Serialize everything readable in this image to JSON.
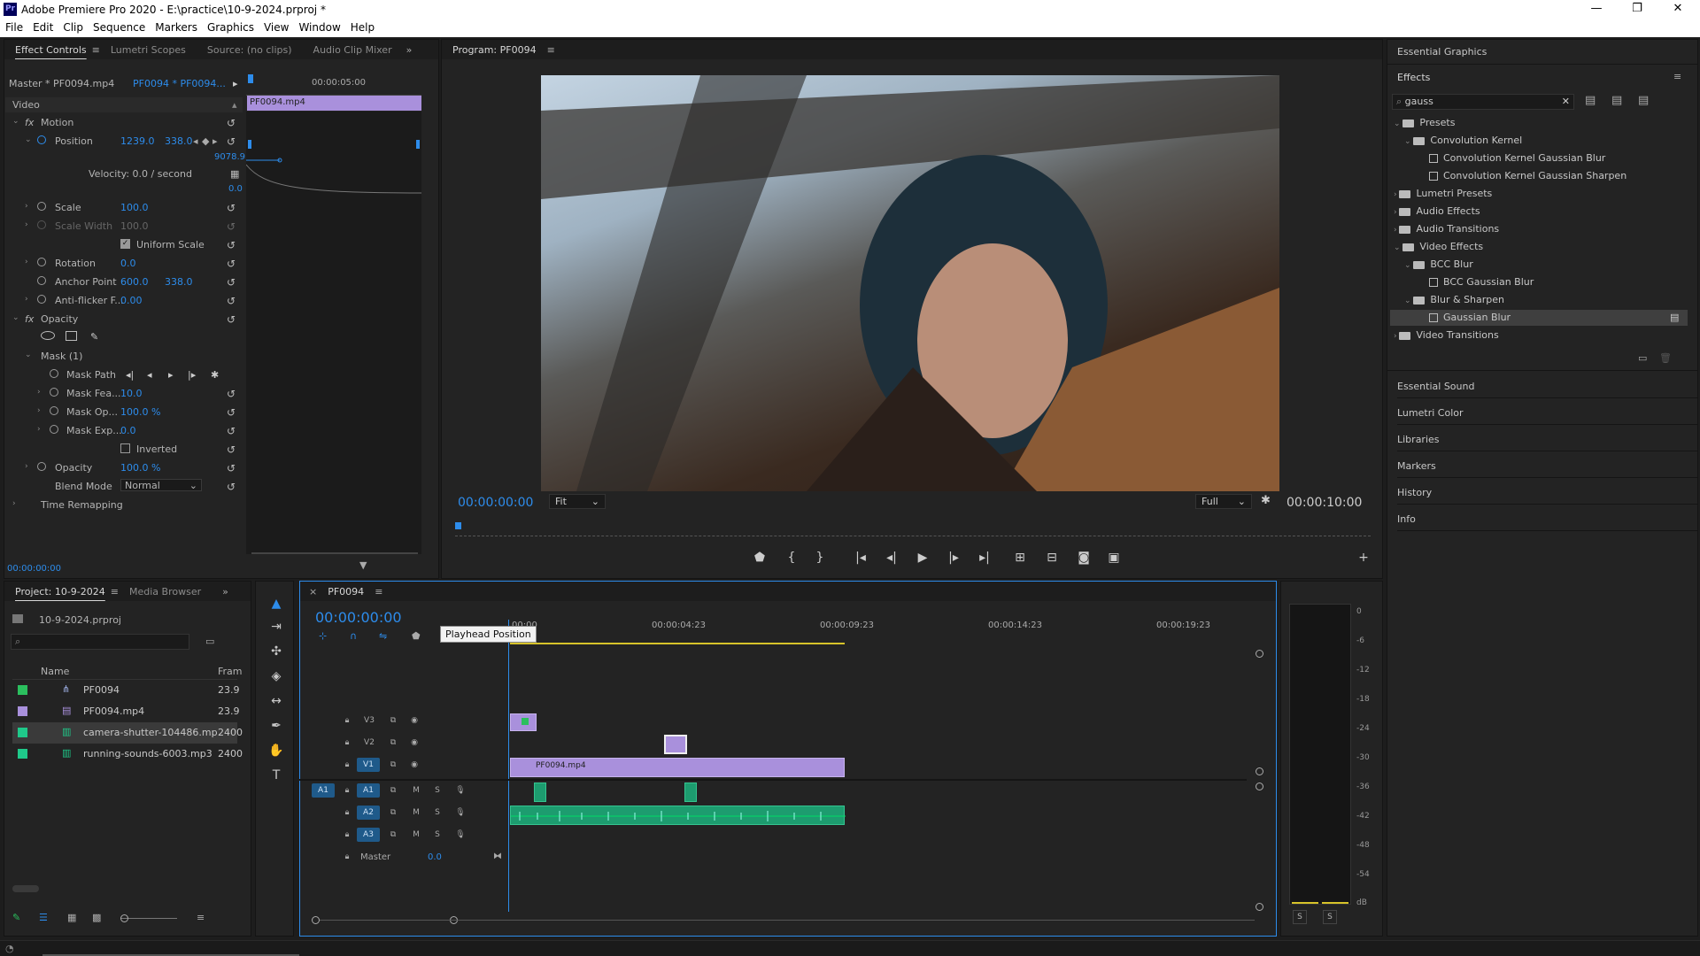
{
  "app": {
    "title": "Adobe Premiere Pro 2020 - E:\\practice\\10-9-2024.prproj *",
    "logo": "Pr",
    "controls": [
      "minimize-icon",
      "maximize-icon",
      "close-icon"
    ]
  },
  "menu": [
    "File",
    "Edit",
    "Clip",
    "Sequence",
    "Markers",
    "Graphics",
    "View",
    "Window",
    "Help"
  ],
  "effect_controls": {
    "tabs": [
      "Effect Controls",
      "Lumetri Scopes",
      "Source: (no clips)",
      "Audio Clip Mixer"
    ],
    "master": "Master * PF0094.mp4",
    "seq": "PF0094 * PF0094...",
    "ruler_time": "00:00:05:00",
    "clip_name": "PF0094.mp4",
    "video_label": "Video",
    "motion": "Motion",
    "position_label": "Position",
    "position_x": "1239.0",
    "position_y": "338.0",
    "velocity_value": "9078.9",
    "velocity": "Velocity: 0.0 / second",
    "velocity_zero": "0.0",
    "scale_label": "Scale",
    "scale": "100.0",
    "scale_width_label": "Scale Width",
    "scale_width": "100.0",
    "uniform_scale": "Uniform Scale",
    "rotation_label": "Rotation",
    "rotation": "0.0",
    "anchor_label": "Anchor Point",
    "anchor_x": "600.0",
    "anchor_y": "338.0",
    "antiflicker_label": "Anti-flicker F...",
    "antiflicker": "0.00",
    "opacity_section": "Opacity",
    "mask": "Mask (1)",
    "mask_path": "Mask Path",
    "mask_feather_label": "Mask Fea...",
    "mask_feather": "10.0",
    "mask_opacity_label": "Mask Op...",
    "mask_opacity": "100.0 %",
    "mask_expansion_label": "Mask Exp...",
    "mask_expansion": "0.0",
    "inverted": "Inverted",
    "opacity_label": "Opacity",
    "opacity": "100.0 %",
    "blend_label": "Blend Mode",
    "blend": "Normal",
    "time_remap": "Time Remapping",
    "timecode": "00:00:00:00"
  },
  "program": {
    "title": "Program: PF0094",
    "timecode": "00:00:00:00",
    "fit": "Fit",
    "quality": "Full",
    "duration": "00:00:10:00"
  },
  "project": {
    "tabs": [
      "Project: 10-9-2024",
      "Media Browser"
    ],
    "file": "10-9-2024.prproj",
    "columns": [
      "Name",
      "Fram"
    ],
    "items": [
      {
        "name": "PF0094",
        "fps": "23.9",
        "color": "#2bbf5e",
        "icon": "sequence-icon"
      },
      {
        "name": "PF0094.mp4",
        "fps": "23.9",
        "color": "#a990dc",
        "icon": "video-file-icon"
      },
      {
        "name": "camera-shutter-104486.mp",
        "fps": "2400",
        "color": "#1fc98a",
        "icon": "audio-file-icon"
      },
      {
        "name": "running-sounds-6003.mp3",
        "fps": "2400",
        "color": "#1fc98a",
        "icon": "audio-file-icon"
      }
    ]
  },
  "timeline": {
    "tab": "PF0094",
    "timecode": "00:00:00:00",
    "tooltip": "Playhead Position",
    "ruler": [
      "00:00",
      "00:00:04:23",
      "00:00:09:23",
      "00:00:14:23",
      "00:00:19:23"
    ],
    "video_tracks": [
      "V3",
      "V2",
      "V1"
    ],
    "audio_tracks": [
      "A1",
      "A2",
      "A3"
    ],
    "master": "Master",
    "master_val": "0.0",
    "clip_v1": "PF0094.mp4",
    "src_a1": "A1",
    "src_v1": "V1",
    "m": "M",
    "s": "S"
  },
  "effects": {
    "essential_graphics": "Essential Graphics",
    "title": "Effects",
    "search": "gauss",
    "tree": [
      {
        "label": "Presets",
        "level": 0,
        "type": "folder",
        "open": true
      },
      {
        "label": "Convolution Kernel",
        "level": 1,
        "type": "folder",
        "open": true
      },
      {
        "label": "Convolution Kernel Gaussian Blur",
        "level": 2,
        "type": "preset"
      },
      {
        "label": "Convolution Kernel Gaussian Sharpen",
        "level": 2,
        "type": "preset"
      },
      {
        "label": "Lumetri Presets",
        "level": 0,
        "type": "folder",
        "open": false
      },
      {
        "label": "Audio Effects",
        "level": 0,
        "type": "folder",
        "open": false
      },
      {
        "label": "Audio Transitions",
        "level": 0,
        "type": "folder",
        "open": false
      },
      {
        "label": "Video Effects",
        "level": 0,
        "type": "folder",
        "open": true
      },
      {
        "label": "BCC Blur",
        "level": 1,
        "type": "folder",
        "open": true
      },
      {
        "label": "BCC Gaussian Blur",
        "level": 2,
        "type": "preset"
      },
      {
        "label": "Blur & Sharpen",
        "level": 1,
        "type": "folder",
        "open": true
      },
      {
        "label": "Gaussian Blur",
        "level": 2,
        "type": "preset",
        "selected": true
      },
      {
        "label": "Video Transitions",
        "level": 0,
        "type": "folder",
        "open": false
      }
    ],
    "panels": [
      "Essential Sound",
      "Lumetri Color",
      "Libraries",
      "Markers",
      "History",
      "Info"
    ]
  },
  "meter": {
    "labels": [
      "0",
      "-6",
      "-12",
      "-18",
      "-24",
      "-30",
      "-36",
      "-42",
      "-48",
      "-54",
      "dB"
    ],
    "solo": [
      "S",
      "S"
    ]
  }
}
